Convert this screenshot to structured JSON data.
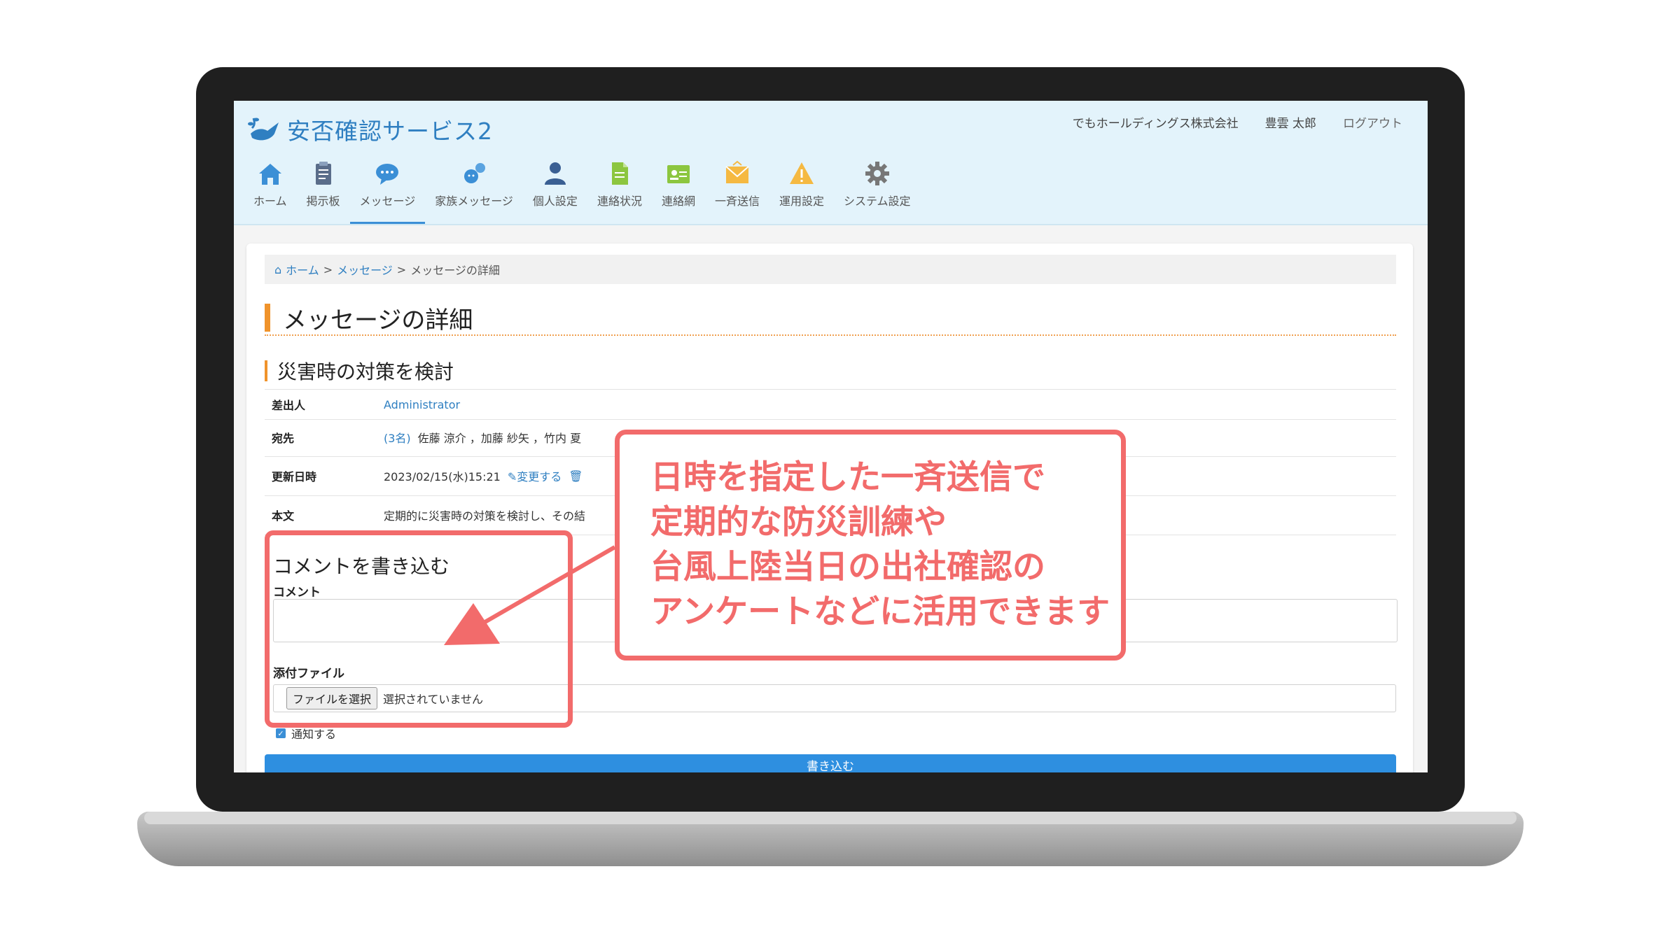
{
  "app": {
    "logo_text": "安否確認サービス2",
    "company": "でもホールディングス株式会社",
    "user": "豊雲 太郎",
    "logout": "ログアウト"
  },
  "nav": [
    {
      "label": "ホーム",
      "icon": "home-icon"
    },
    {
      "label": "掲示板",
      "icon": "clipboard-icon"
    },
    {
      "label": "メッセージ",
      "icon": "chat-bubble-icon",
      "active": true
    },
    {
      "label": "家族メッセージ",
      "icon": "family-chat-icon"
    },
    {
      "label": "個人設定",
      "icon": "person-icon"
    },
    {
      "label": "連絡状況",
      "icon": "document-icon"
    },
    {
      "label": "連絡網",
      "icon": "contact-card-icon"
    },
    {
      "label": "一斉送信",
      "icon": "envelope-icon"
    },
    {
      "label": "運用設定",
      "icon": "warning-icon"
    },
    {
      "label": "システム設定",
      "icon": "gear-icon"
    }
  ],
  "breadcrumb": {
    "home": "ホーム",
    "sep1": ">",
    "message": "メッセージ",
    "sep2": ">",
    "current": "メッセージの詳細"
  },
  "page_title": "メッセージの詳細",
  "message": {
    "subject": "災害時の対策を検討",
    "sender_label": "差出人",
    "sender": "Administrator",
    "recipient_label": "宛先",
    "recipient_count": "(3名)",
    "recipients": "佐藤 涼介 ，加藤 紗矢 ，竹内 夏",
    "updated_label": "更新日時",
    "updated": "2023/02/15(水)15:21",
    "edit_link": "変更する",
    "body_label": "本文",
    "body": "定期的に災害時の対策を検討し、その結"
  },
  "comment_form": {
    "title": "コメントを書き込む",
    "comment_label": "コメント",
    "attachment_label": "添付ファイル",
    "file_button": "ファイルを選択",
    "file_status": "選択されていません",
    "notify_label": "通知する",
    "submit": "書き込む"
  },
  "callout": {
    "line1": "日時を指定した一斉送信で",
    "line2": "定期的な防災訓練や",
    "line3": "台風上陸当日の出社確認の",
    "line4": "アンケートなどに活用できます"
  },
  "colors": {
    "accent": "#2f7fc1",
    "header_bg": "#e3f3fb",
    "title_bar": "#f0932b",
    "callout": "#f26b6b",
    "submit": "#2e8fe0"
  }
}
